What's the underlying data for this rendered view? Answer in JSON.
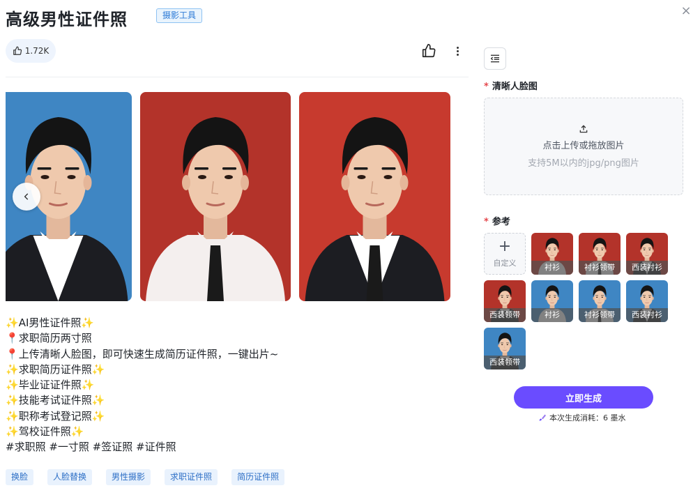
{
  "header": {
    "title": "高级男性证件照",
    "tag": "摄影工具",
    "close_icon": "×"
  },
  "toolbar": {
    "like_count": "1.72K"
  },
  "gallery": {
    "photos": [
      {
        "background": "#3f86c3",
        "shirt": "#ffffff",
        "suit": "#1c1d22",
        "tie": null
      },
      {
        "background": "#b3332a",
        "shirt": "#f4efee",
        "suit": null,
        "tie": "#1a1a1a"
      },
      {
        "background": "#c73a2e",
        "shirt": "#ffffff",
        "suit": "#1c1d22",
        "tie": "#1a1a1a"
      }
    ],
    "prev_icon": "chevron-left-icon"
  },
  "description": {
    "lines": [
      {
        "prefix": "✨",
        "text": "AI男性证件照",
        "suffix": "✨"
      },
      {
        "prefix": "📍",
        "text": "求职简历两寸照",
        "suffix": ""
      },
      {
        "prefix": "📍",
        "text": "上传清晰人脸图，即可快速生成简历证件照，一键出片~",
        "suffix": ""
      },
      {
        "prefix": "✨",
        "text": "求职简历证件照",
        "suffix": "✨"
      },
      {
        "prefix": "✨",
        "text": "毕业证证件照",
        "suffix": "✨"
      },
      {
        "prefix": "✨",
        "text": "技能考试证件照",
        "suffix": "✨"
      },
      {
        "prefix": "✨",
        "text": "职称考试登记照",
        "suffix": "✨"
      },
      {
        "prefix": "✨",
        "text": "驾校证件照",
        "suffix": "✨"
      },
      {
        "prefix": "",
        "text": "#求职照 #一寸照 #签证照 #证件照",
        "suffix": ""
      }
    ]
  },
  "tags": [
    "换脸",
    "人脸替换",
    "男性摄影",
    "求职证件照",
    "简历证件照"
  ],
  "panel": {
    "face_label": "清晰人脸图",
    "required_mark": "*",
    "upload_main": "点击上传或拖放图片",
    "upload_sub": "支持5M以内的jpg/png图片",
    "reference_label": "参考",
    "custom_label": "自定义",
    "custom_plus": "+",
    "references": [
      {
        "label": "衬衫",
        "background": "#b3332a",
        "suit": false,
        "tie": false
      },
      {
        "label": "衬衫领带",
        "background": "#b3332a",
        "suit": false,
        "tie": true
      },
      {
        "label": "西装衬衫",
        "background": "#b3332a",
        "suit": true,
        "tie": false
      },
      {
        "label": "西装领带",
        "background": "#b3332a",
        "suit": true,
        "tie": true
      },
      {
        "label": "衬衫",
        "background": "#3f86c3",
        "suit": false,
        "tie": false
      },
      {
        "label": "衬衫领带",
        "background": "#3f86c3",
        "suit": false,
        "tie": true
      },
      {
        "label": "西装衬衫",
        "background": "#3f86c3",
        "suit": true,
        "tie": false
      },
      {
        "label": "西装领带",
        "background": "#3f86c3",
        "suit": true,
        "tie": true
      }
    ],
    "generate_label": "立即生成",
    "cost_text": "本次生成消耗：6 墨水"
  },
  "colors": {
    "accent": "#6a4cff",
    "tag_blue": "#2d6fc6",
    "required": "#e5484d"
  }
}
